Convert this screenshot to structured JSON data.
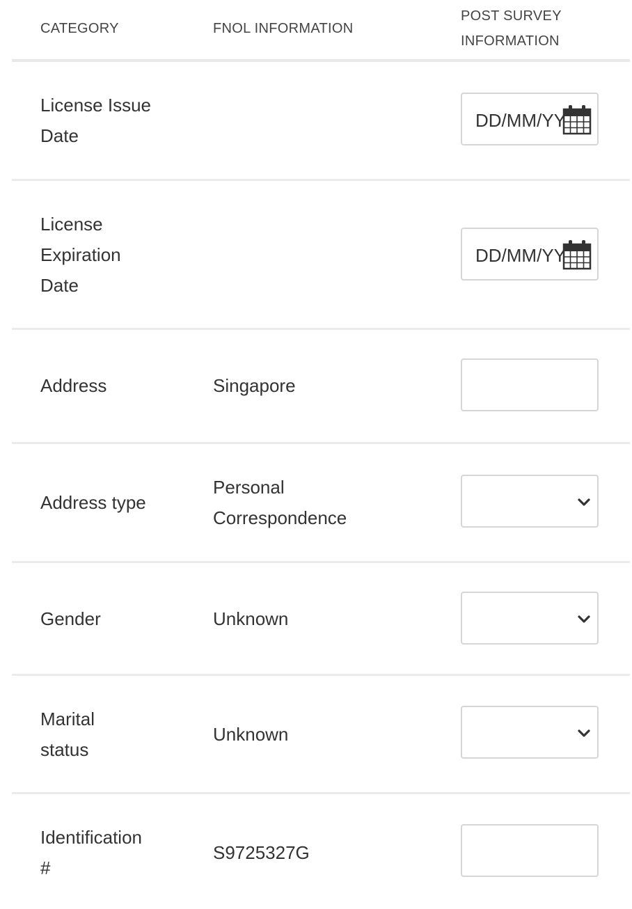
{
  "header": {
    "category": "CATEGORY",
    "fnol": "FNOL INFORMATION",
    "post_survey_line1": "POST SURVEY",
    "post_survey_line2": "INFORMATION"
  },
  "rows": [
    {
      "category_lines": [
        "License Issue",
        "Date"
      ],
      "fnol": "",
      "field_type": "date",
      "placeholder": "DD/MM/YYYY",
      "icon": "calendar-icon"
    },
    {
      "category_lines": [
        "License",
        "Expiration",
        "Date"
      ],
      "fnol": "",
      "field_type": "date",
      "placeholder": "DD/MM/YYYY",
      "icon": "calendar-icon"
    },
    {
      "category_lines": [
        "Address"
      ],
      "fnol_lines": [
        "Singapore"
      ],
      "field_type": "text",
      "value": ""
    },
    {
      "category_lines": [
        "Address type"
      ],
      "fnol_lines": [
        "Personal",
        "Correspondence"
      ],
      "field_type": "select",
      "value": "",
      "icon": "chevron-down-icon"
    },
    {
      "category_lines": [
        "Gender"
      ],
      "fnol_lines": [
        "Unknown"
      ],
      "field_type": "select",
      "value": "",
      "icon": "chevron-down-icon"
    },
    {
      "category_lines": [
        "Marital",
        "status"
      ],
      "fnol_lines": [
        "Unknown"
      ],
      "field_type": "select",
      "value": "",
      "icon": "chevron-down-icon"
    },
    {
      "category_lines": [
        "Identification",
        "#"
      ],
      "fnol_lines": [
        "S9725327G"
      ],
      "field_type": "text",
      "value": ""
    }
  ],
  "colors": {
    "text": "#333333",
    "border": "#d6d6d6",
    "divider": "#ebebeb"
  }
}
